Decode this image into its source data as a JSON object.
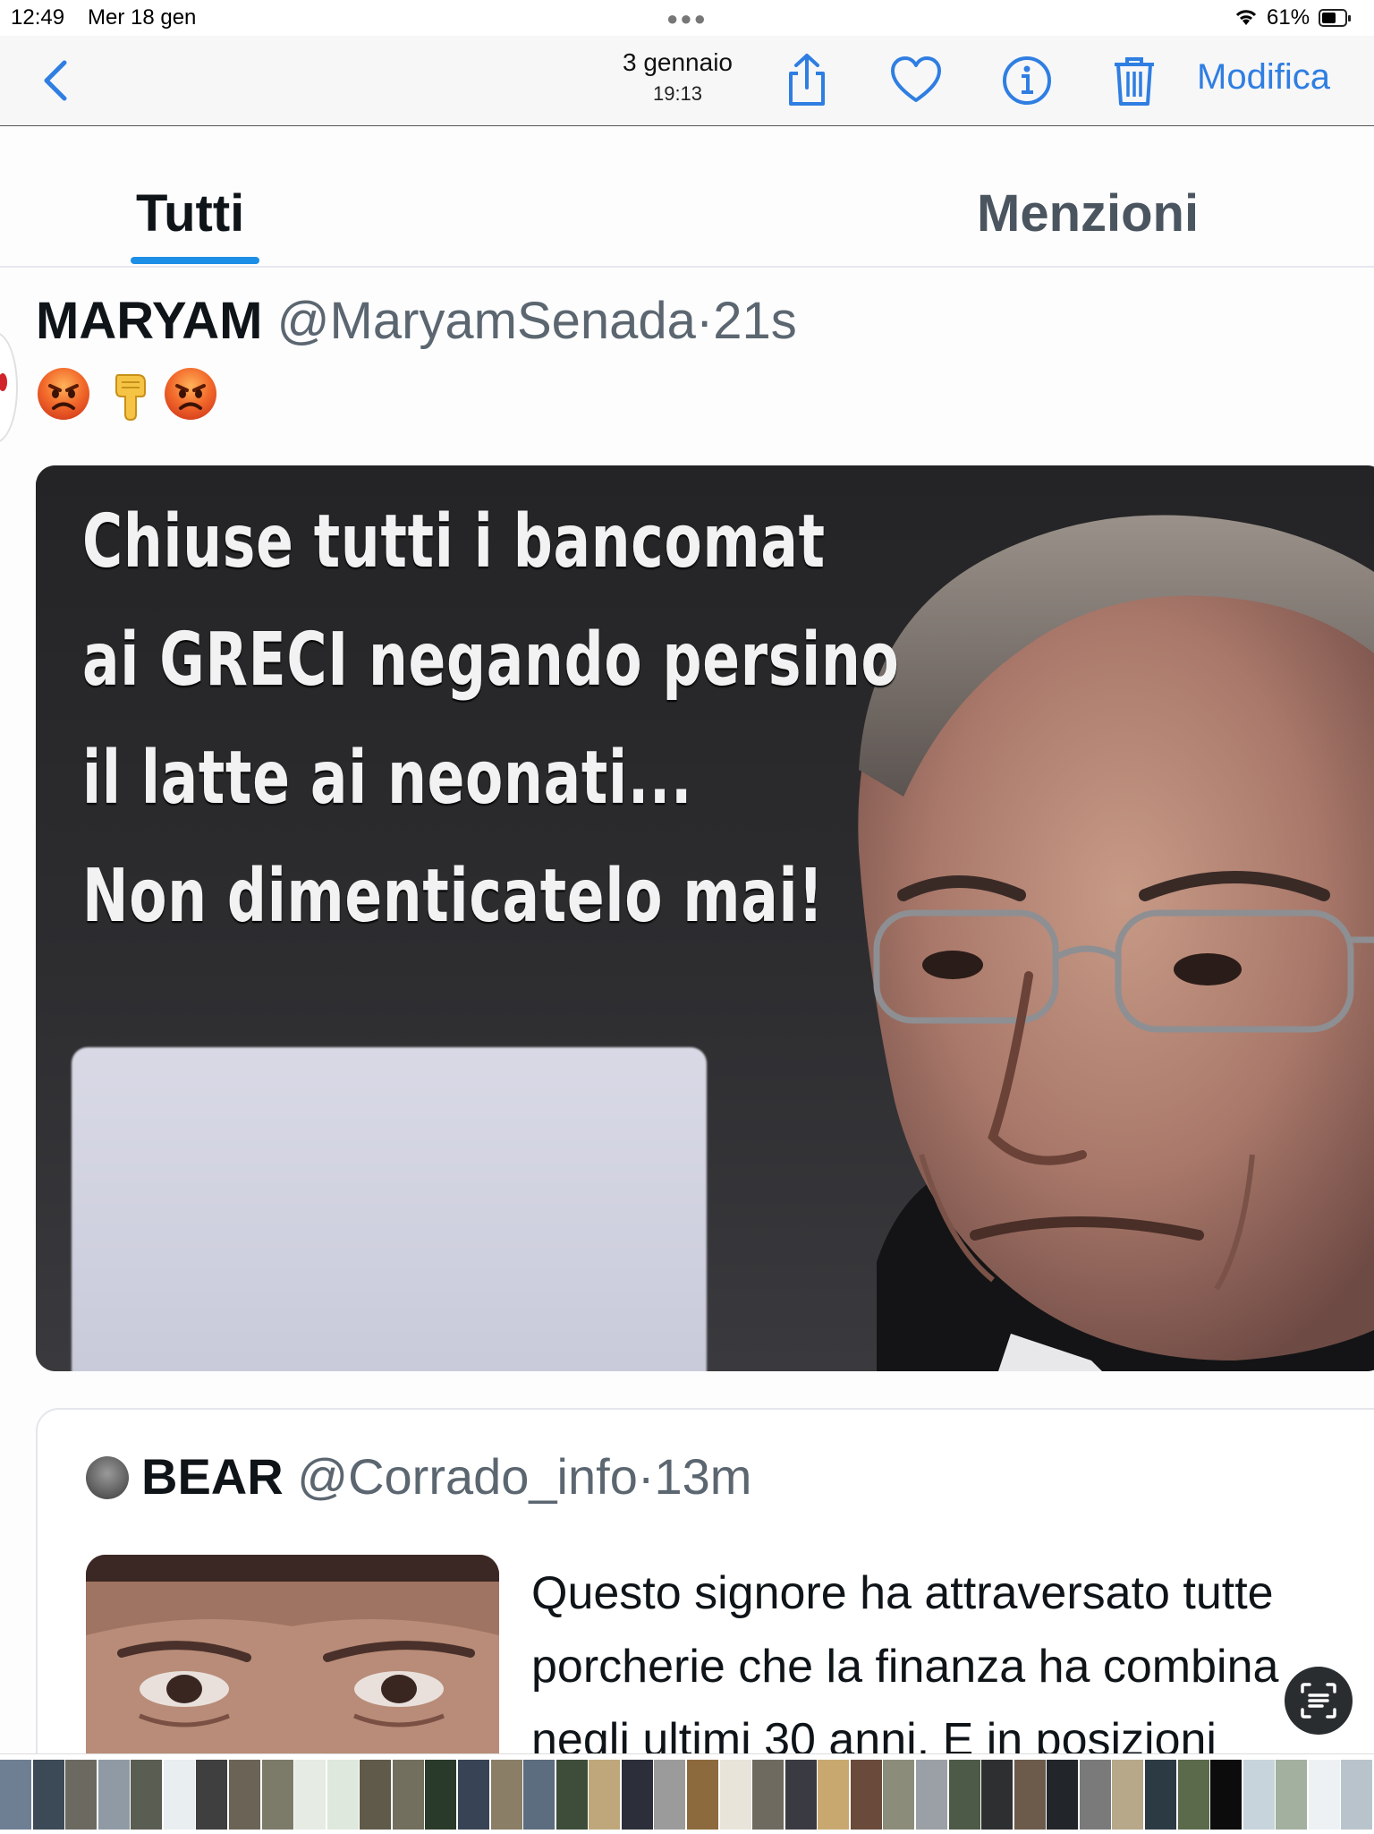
{
  "status_bar": {
    "time": "12:49",
    "date": "Mer 18 gen",
    "battery_percent": "61%",
    "battery_level": 0.61
  },
  "toolbar": {
    "date": "3 gennaio",
    "time": "19:13",
    "edit_label": "Modifica",
    "accent_color": "#2f7ee2",
    "icons": [
      "chevron-left-icon",
      "share-icon",
      "heart-icon",
      "info-icon",
      "trash-icon"
    ]
  },
  "tweet_screenshot": {
    "tabs": [
      {
        "label": "Tutti",
        "active": true
      },
      {
        "label": "Menzioni",
        "active": false
      }
    ],
    "tweet": {
      "author_name": "MARYAM",
      "handle": "@MaryamSenada",
      "separator": "·",
      "age": "21s",
      "emojis": [
        "angry-face",
        "pointing-down",
        "angry-face"
      ],
      "image_caption": [
        "Chiuse tutti i bancomat",
        "ai GRECI negando persino",
        "il latte ai neonati...",
        "Non dimenticatelo mai!"
      ]
    },
    "quoted_tweet": {
      "author_name": "BEAR",
      "handle": "@Corrado_info",
      "separator": "·",
      "age": "13m",
      "text_lines": [
        "Questo signore ha attraversato tutte",
        "porcherie che la finanza ha combina",
        "negli ultimi 30 anni. E in posizioni"
      ]
    }
  },
  "thumbnail_strip": {
    "colors": [
      "#6e7f94",
      "#3c4a57",
      "#6c6a60",
      "#8f9aa4",
      "#5a5e52",
      "#e9eef0",
      "#3f3f40",
      "#6b6456",
      "#7c7b6a",
      "#e6ebe3",
      "#dfe8dd",
      "#5f5a4a",
      "#726f5e",
      "#2a3a2a",
      "#384455",
      "#8a7e66",
      "#5b6d7e",
      "#3d4d3a",
      "#c0a77b",
      "#2c2f3a",
      "#9b9b9b",
      "#8d6a3d",
      "#e8e4da",
      "#6f6a60",
      "#3a3a42",
      "#c9a870",
      "#6a4a3a",
      "#8c8c7a",
      "#9aa0a6",
      "#4e5a48",
      "#2e2f30",
      "#6c5a4a",
      "#22252a",
      "#7a7a7a",
      "#b7a88a",
      "#2c3a44",
      "#5a6a4a",
      "#0c0c0c",
      "#c7d4dc",
      "#a3b0a0",
      "#eef1f3",
      "#b9c3cc"
    ]
  }
}
